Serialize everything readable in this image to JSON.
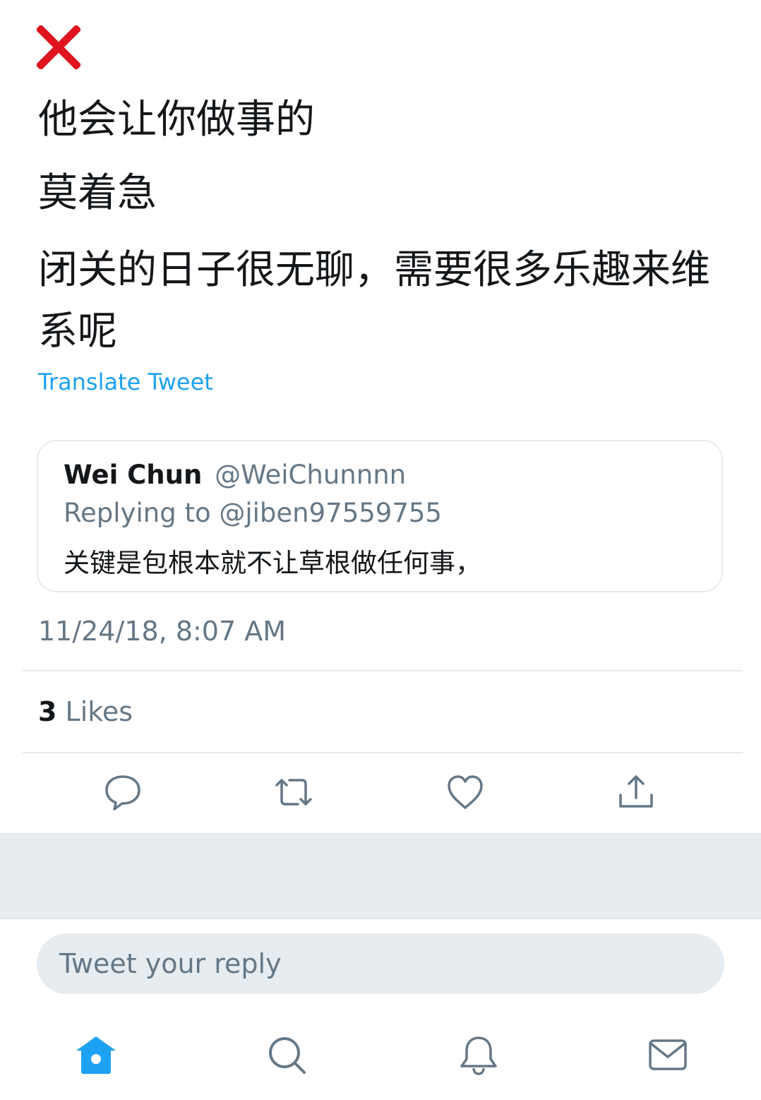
{
  "tweet": {
    "lines": [
      "他会让你做事的",
      "莫着急",
      "闭关的日子很无聊，需要很多乐趣来维系呢"
    ],
    "translate_label": "Translate Tweet",
    "timestamp": "11/24/18, 8:07 AM"
  },
  "quoted_tweet": {
    "name": "Wei Chun",
    "handle": "@WeiChunnnn",
    "replying_to": "Replying to @jiben97559755",
    "text": "关键是包根本就不让草根做任何事，"
  },
  "stats": {
    "likes_count": "3",
    "likes_label": "Likes"
  },
  "reply_input": {
    "placeholder": "Tweet your reply"
  },
  "icons": {
    "overlay_mark": "red-x-icon",
    "actions": [
      "reply-icon",
      "retweet-icon",
      "like-icon",
      "share-icon"
    ],
    "tabbar": [
      "home-icon",
      "search-icon",
      "notifications-icon",
      "messages-icon"
    ]
  },
  "colors": {
    "accent": "#1da1f2",
    "mark": "#e0141e",
    "icon": "#657786",
    "divider": "#e6ecf0"
  }
}
